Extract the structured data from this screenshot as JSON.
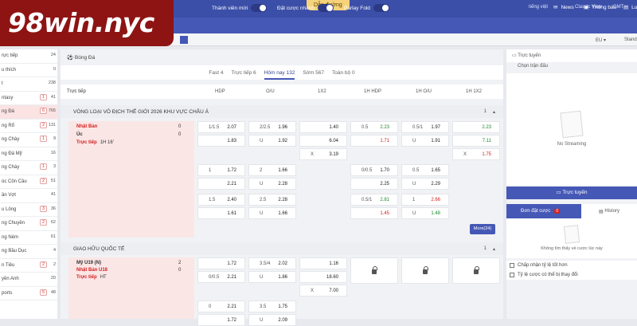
{
  "guide": "Dẫn đường",
  "top_right": {
    "lang": "tiếng việt",
    "view": "Classic View",
    "tz": "GMT"
  },
  "nav": {
    "member": "Thành viên mới",
    "fast_bet": "Đặt cược nhanh",
    "parlay": "Parlay Fold",
    "news": "News",
    "notice": "Thông báo",
    "rules": "Lu"
  },
  "subbar": {
    "odds_type": "EU",
    "standard": "Stand"
  },
  "logo": "98win.nyc",
  "sidebar": [
    {
      "label": "rực tiếp",
      "count": "24",
      "live": ""
    },
    {
      "label": "u thích",
      "count": "0",
      "live": ""
    },
    {
      "label": "t",
      "count": "238",
      "live": ""
    },
    {
      "label": "ntasy",
      "count": "41",
      "live": "1"
    },
    {
      "label": "ng Đá",
      "count": "765",
      "live": "6",
      "active": true
    },
    {
      "label": "ng Rổ",
      "count": "131",
      "live": "2"
    },
    {
      "label": "ng Chày",
      "count": "9",
      "live": "1"
    },
    {
      "label": "ng Đá Mỹ",
      "count": "16",
      "live": ""
    },
    {
      "label": "ng Chày",
      "count": "3",
      "live": "1"
    },
    {
      "label": "úc Côn Cầu",
      "count": "51",
      "live": "2"
    },
    {
      "label": "ần Vợt",
      "count": "41",
      "live": ""
    },
    {
      "label": "u Lông",
      "count": "36",
      "live": "3"
    },
    {
      "label": "ng Chuyền",
      "count": "62",
      "live": "2"
    },
    {
      "label": "ng Ném",
      "count": "61",
      "live": ""
    },
    {
      "label": "ng Bầu Dục",
      "count": "4",
      "live": ""
    },
    {
      "label": "n Tiêu",
      "count": "2",
      "live": "2"
    },
    {
      "label": "yền Anh",
      "count": "20",
      "live": ""
    },
    {
      "label": "ports",
      "count": "48",
      "live": "5"
    }
  ],
  "breadcrumb": "Bóng Đá",
  "tabs": [
    {
      "label": "Fast 4",
      "active": false
    },
    {
      "label": "Trực tiếp 6",
      "active": false
    },
    {
      "label": "Hôm nay 132",
      "active": true
    },
    {
      "label": "Sớm 567",
      "active": false
    },
    {
      "label": "Toàn bộ 0",
      "active": false
    }
  ],
  "columns": {
    "live": "Trực tiếp",
    "hdp": "HDP",
    "ou": "O/U",
    "x12": "1X2",
    "h1hdp": "1H HDP",
    "h1ou": "1H O/U",
    "h1x12": "1H 1X2"
  },
  "league1": {
    "name": "VÒNG LOẠI VÔ ĐỊCH THẾ GIỚI 2026 KHU VỰC CHÂU Á",
    "count": "1"
  },
  "match1": {
    "home": "Nhật Bản",
    "away": "Úc",
    "home_score": "0",
    "away_score": "0",
    "status": "Trực tiếp",
    "time": "1H 16'"
  },
  "league2": {
    "name": "GIAO HỮU QUỐC TẾ",
    "count": "1"
  },
  "match2": {
    "home": "Mỹ U19 (N)",
    "away": "Nhật Bản U18",
    "home_score": "2",
    "away_score": "0",
    "status": "Trực tiếp",
    "time": "HT"
  },
  "more": "More(24)",
  "right": {
    "live_title": "Trực tuyến",
    "choose_match": "Chọn trận đấu",
    "no_streaming": "No Streaming",
    "live_button": "Trực tuyến",
    "bet_slip": "Đơn đặt cược",
    "bet_count": "0",
    "history": "History",
    "empty": "Không tìm thấy vé cược lúc này",
    "opt1": "Chấp nhận tỷ lệ tốt hơn",
    "opt2": "Tỷ lệ cược có thể bị thay đổi"
  }
}
